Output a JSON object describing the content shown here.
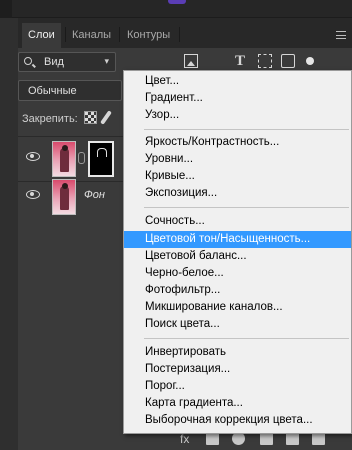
{
  "tabs": [
    {
      "label": "Слои",
      "active": true
    },
    {
      "label": "Каналы",
      "active": false
    },
    {
      "label": "Контуры",
      "active": false
    }
  ],
  "filter": {
    "kind_label": "Вид"
  },
  "blend_mode": "Обычные",
  "lock_label": "Закрепить:",
  "layers": [
    {
      "name": "",
      "has_mask": true
    },
    {
      "name": "Фон",
      "has_mask": false
    }
  ],
  "menu_groups": [
    [
      "Цвет...",
      "Градиент...",
      "Узор..."
    ],
    [
      "Яркость/Контрастность...",
      "Уровни...",
      "Кривые...",
      "Экспозиция..."
    ],
    [
      "Сочность...",
      "Цветовой тон/Насыщенность...",
      "Цветовой баланс...",
      "Черно-белое...",
      "Фотофильтр...",
      "Микширование каналов...",
      "Поиск цвета..."
    ],
    [
      "Инвертировать",
      "Постеризация...",
      "Порог...",
      "Карта градиента...",
      "Выборочная коррекция цвета..."
    ]
  ],
  "menu_selected": "Цветовой тон/Насыщенность...",
  "colors": {
    "selection": "#3399ff",
    "panel": "#3a3a3a",
    "menu_bg": "#f0f0f0"
  }
}
